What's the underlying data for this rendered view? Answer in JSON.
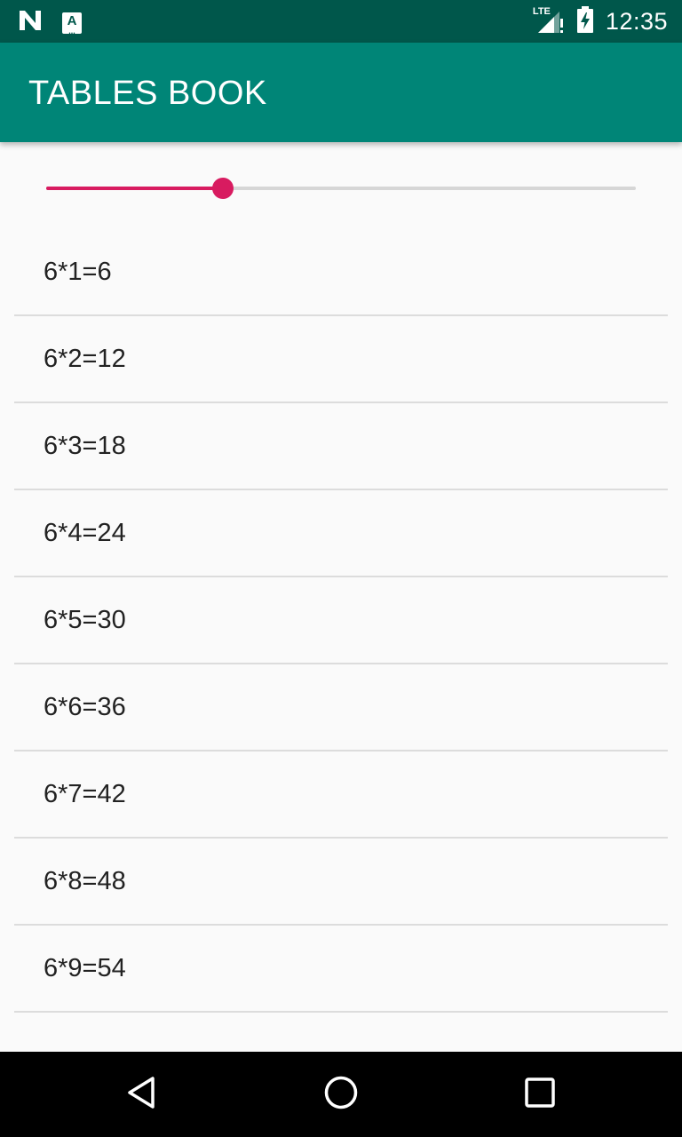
{
  "status_bar": {
    "time": "12:35",
    "network_label": "LTE",
    "icons": [
      "n-notification-icon",
      "a-notification-icon",
      "lte-signal-icon",
      "battery-charging-icon"
    ]
  },
  "app_bar": {
    "title": "TABLES BOOK"
  },
  "slider": {
    "value_fraction": 0.3,
    "colors": {
      "active": "#d81b60",
      "inactive": "#d6d6d6"
    }
  },
  "table": {
    "rows": [
      "6*1=6",
      "6*2=12",
      "6*3=18",
      "6*4=24",
      "6*5=30",
      "6*6=36",
      "6*7=42",
      "6*8=48",
      "6*9=54"
    ]
  },
  "nav_bar": {
    "buttons": [
      "back-icon",
      "home-icon",
      "recents-icon"
    ]
  },
  "colors": {
    "status_bar": "#00574b",
    "app_bar": "#008577",
    "accent": "#d81b60",
    "background": "#fafafa"
  }
}
